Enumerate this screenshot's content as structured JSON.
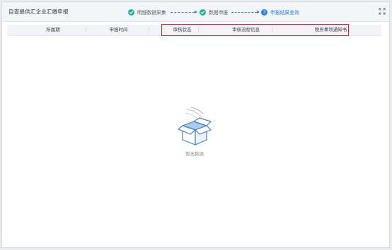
{
  "app": {
    "title": "自查提供汇企业汇缴申报"
  },
  "steps": [
    {
      "label": "明细数据采集",
      "state": "done",
      "icon": "check-icon"
    },
    {
      "label": "数据申报",
      "state": "done",
      "icon": "check-icon"
    },
    {
      "number": "3",
      "label": "申报结果查询",
      "state": "current"
    }
  ],
  "table": {
    "columns": [
      "所属期",
      "申报时间",
      "审核状态",
      "审核流程信息",
      "税务事项通知书"
    ]
  },
  "empty_state": {
    "label": "暂无数据",
    "icon": "empty-box-icon"
  },
  "colors": {
    "step_done": "#25b396",
    "step_current": "#2b7ee0",
    "highlight": "#d8242a"
  },
  "icons": {
    "expand": "expand-icon"
  }
}
